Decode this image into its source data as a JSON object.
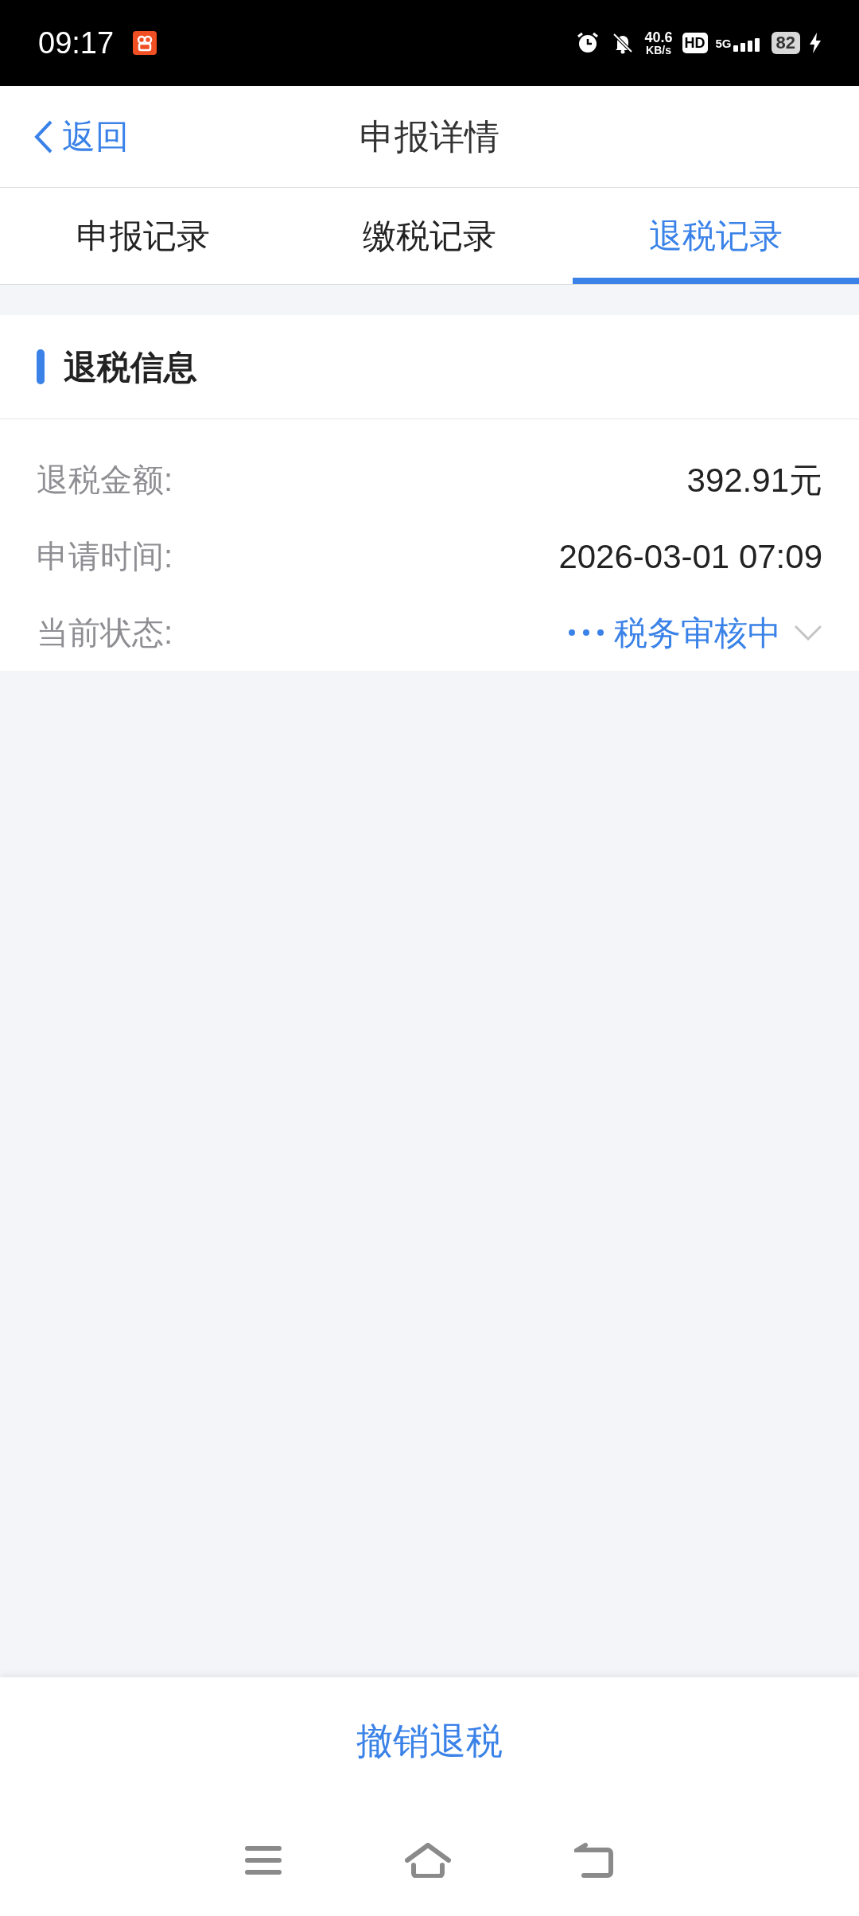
{
  "status_bar": {
    "time": "09:17",
    "net_speed": "40.6",
    "net_unit": "KB/s",
    "hd": "HD",
    "network": "5G",
    "battery": "82"
  },
  "header": {
    "back": "返回",
    "title": "申报详情"
  },
  "tabs": [
    {
      "label": "申报记录",
      "selected": false
    },
    {
      "label": "缴税记录",
      "selected": false
    },
    {
      "label": "退税记录",
      "selected": true
    }
  ],
  "section": {
    "title": "退税信息"
  },
  "rows": [
    {
      "kind": "text",
      "label": "退税金额:",
      "value": "392.91元"
    },
    {
      "kind": "text",
      "label": "申请时间:",
      "value": "2026-03-01 07:09"
    },
    {
      "kind": "status",
      "label": "当前状态:",
      "value": "税务审核中",
      "expanded": false
    }
  ],
  "action": {
    "label": "撤销退税"
  }
}
